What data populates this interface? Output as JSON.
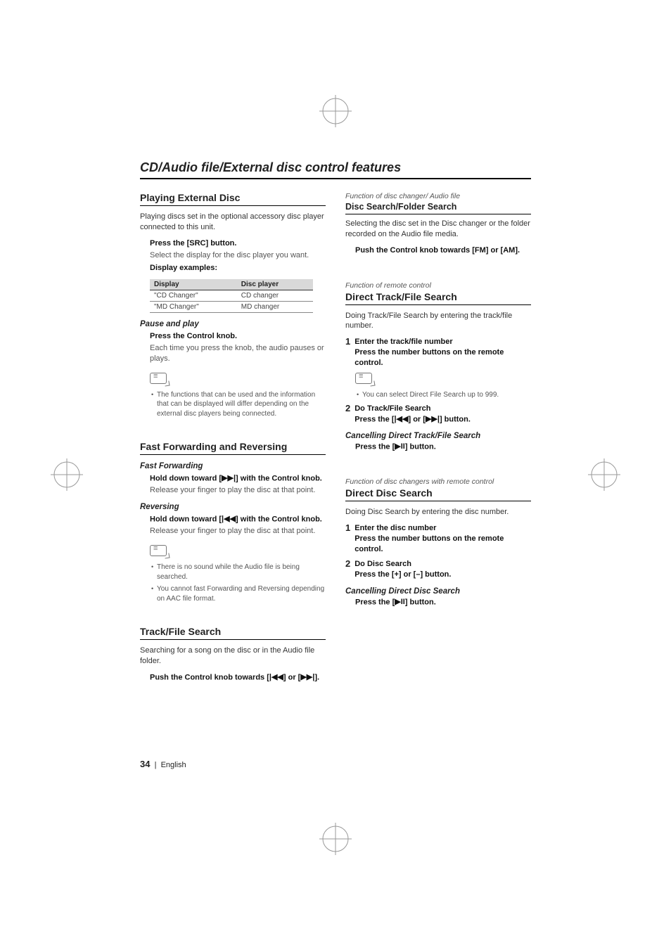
{
  "page_title": "CD/Audio file/External disc control features",
  "footer": {
    "page_number": "34",
    "lang": "English"
  },
  "left": {
    "sec1": {
      "heading": "Playing External Disc",
      "intro": "Playing discs set in the optional accessory disc player connected to this unit.",
      "step1a": "Press the [SRC] button.",
      "step1b": "Select the display for the disc player you want.",
      "step1c": "Display examples:",
      "table": {
        "h1": "Display",
        "h2": "Disc player",
        "r1c1": "\"CD Changer\"",
        "r1c2": "CD changer",
        "r2c1": "\"MD Changer\"",
        "r2c2": "MD changer"
      },
      "pause_head": "Pause and play",
      "pause_step": "Press the Control knob.",
      "pause_desc": "Each time you press the knob, the audio pauses or plays.",
      "note1": "The functions that can be used and the information that can be displayed will differ depending on the external disc players being connected."
    },
    "sec2": {
      "heading": "Fast Forwarding and Reversing",
      "ff_head": "Fast Forwarding",
      "ff_step_a": "Hold down toward [",
      "ff_step_b": "] with the Control knob.",
      "ff_desc": "Release your finger to play the disc at that point.",
      "rev_head": "Reversing",
      "rev_step_a": "Hold down toward [",
      "rev_step_b": "] with the Control knob.",
      "rev_desc": "Release your finger to play the disc at that point.",
      "note1": "There is no sound while the Audio file is being searched.",
      "note2": "You cannot fast Forwarding and Reversing depending on AAC file format."
    },
    "sec3": {
      "heading": "Track/File Search",
      "intro": "Searching for a song on the disc or in the Audio file folder.",
      "step_a": "Push the Control knob towards [",
      "step_b": "] or [",
      "step_c": "]."
    }
  },
  "right": {
    "sec1": {
      "fn": "Function of disc changer/ Audio file",
      "heading": "Disc Search/Folder Search",
      "intro": "Selecting the disc set in the Disc changer or the folder recorded on the Audio file media.",
      "step": "Push the Control knob towards [FM] or [AM]."
    },
    "sec2": {
      "fn": "Function of remote control",
      "heading": "Direct Track/File Search",
      "intro": "Doing Track/File Search by entering the track/file number.",
      "s1_title": "Enter the track/file number",
      "s1_body": "Press the number buttons on the remote control.",
      "note1": "You can select Direct File Search up to 999.",
      "s2_title": "Do Track/File Search",
      "s2_body_a": "Press the [",
      "s2_body_b": "] or [",
      "s2_body_c": "] button.",
      "cancel_head": "Cancelling Direct Track/File Search",
      "cancel_a": "Press the [",
      "cancel_b": "] button."
    },
    "sec3": {
      "fn": "Function of disc changers with remote control",
      "heading": "Direct Disc Search",
      "intro": "Doing Disc Search by entering the disc number.",
      "s1_title": "Enter the disc number",
      "s1_body": "Press the number buttons on the remote control.",
      "s2_title": "Do Disc Search",
      "s2_body": "Press the [+] or [–] button.",
      "cancel_head": "Cancelling Direct Disc Search",
      "cancel_a": "Press the [",
      "cancel_b": "] button."
    }
  }
}
